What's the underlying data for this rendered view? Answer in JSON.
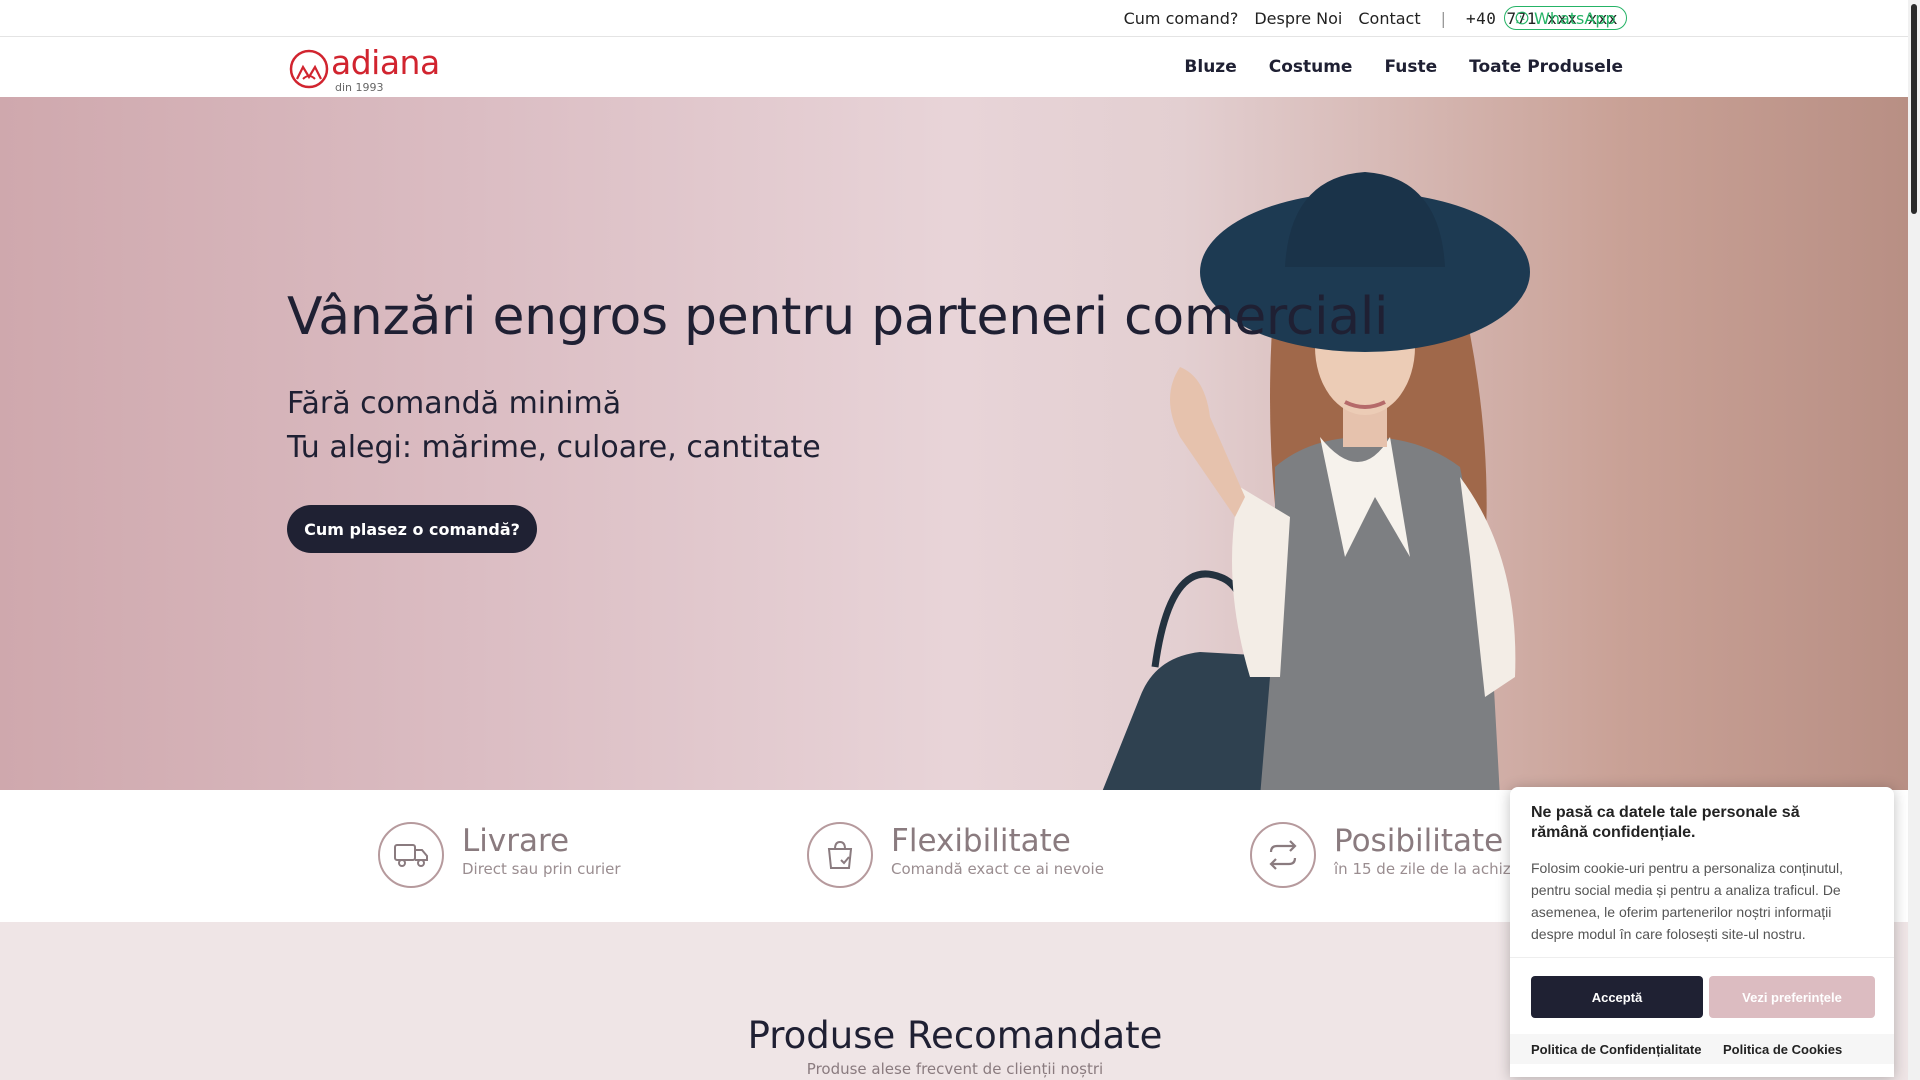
{
  "topbar": {
    "links": [
      "Cum comand?",
      "Despre Noi",
      "Contact"
    ],
    "separator": "|",
    "phone": "+40 771 xxx xxx",
    "whatsapp": "WhatsApp"
  },
  "header": {
    "logo_text": "adiana",
    "logo_since": "din 1993",
    "nav": [
      "Bluze",
      "Costume",
      "Fuste",
      "Toate Produsele"
    ]
  },
  "hero": {
    "title": "Vânzări engros pentru parteneri comerciali",
    "line1": "Fără comandă minimă",
    "line2": "Tu alegi: mărime, culoare, cantitate",
    "cta": "Cum plasez o comandă?"
  },
  "features": [
    {
      "title": "Livrare",
      "desc": "Direct sau prin curier",
      "icon": "truck-icon"
    },
    {
      "title": "Flexibilitate",
      "desc": "Comandă exact ce ai nevoie",
      "icon": "shopping-bag-check-icon"
    },
    {
      "title": "Posibilitate R",
      "desc": "în 15 de zile de la achizi",
      "icon": "return-arrows-icon"
    }
  ],
  "products": {
    "title": "Produse Recomandate",
    "subtitle": "Produse alese frecvent de clienții noștri"
  },
  "cookie": {
    "title": "Ne pasă ca datele tale personale să rămână confidențiale.",
    "body": "Folosim cookie-uri pentru a personaliza conținutul, pentru social media și pentru a analiza traficul. De asemenea, le oferim partenerilor noștri informații despre modul în care folosești site-ul nostru.",
    "accept": "Acceptă",
    "preferences": "Vezi preferințele",
    "privacy": "Politica de Confidențialitate",
    "cookies": "Politica de Cookies"
  },
  "colors": {
    "brand_red": "#d1242f",
    "dark_navy": "#1f2133",
    "whatsapp_green": "#25b366",
    "hero_rose": "#dbbdc3",
    "section_bg": "#efe5e6"
  }
}
